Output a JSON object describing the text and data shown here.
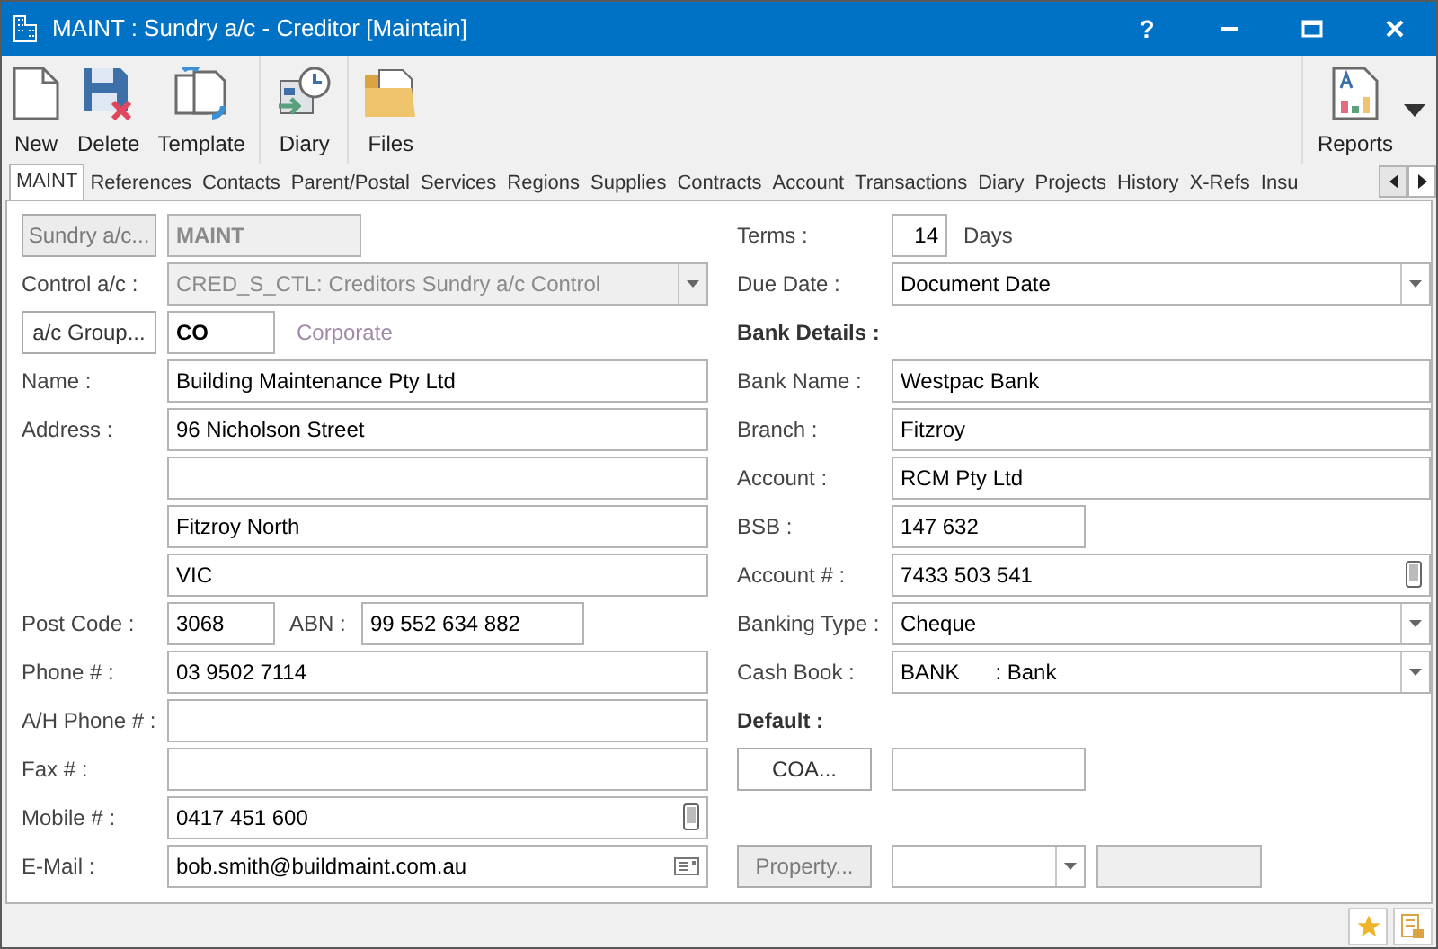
{
  "window": {
    "title": "MAINT : Sundry a/c - Creditor [Maintain]",
    "help": "?"
  },
  "toolbar": {
    "groups": [
      [
        {
          "label": "New"
        },
        {
          "label": "Delete"
        },
        {
          "label": "Template"
        }
      ],
      [
        {
          "label": "Diary"
        }
      ],
      [
        {
          "label": "Files"
        }
      ]
    ],
    "right": [
      {
        "label": "Reports"
      }
    ]
  },
  "tabs": [
    {
      "label": "MAINT",
      "selected": true
    },
    {
      "label": "References",
      "selected": false
    },
    {
      "label": "Contacts",
      "selected": false
    },
    {
      "label": "Parent/Postal",
      "selected": false
    },
    {
      "label": "Services",
      "selected": false
    },
    {
      "label": "Regions",
      "selected": false
    },
    {
      "label": "Supplies",
      "selected": false
    },
    {
      "label": "Contracts",
      "selected": false
    },
    {
      "label": "Account",
      "selected": false
    },
    {
      "label": "Transactions",
      "selected": false
    },
    {
      "label": "Diary",
      "selected": false
    },
    {
      "label": "Projects",
      "selected": false
    },
    {
      "label": "History",
      "selected": false
    },
    {
      "label": "X-Refs",
      "selected": false
    },
    {
      "label": "Insu",
      "selected": false
    }
  ],
  "left": [
    {
      "kind": "button-field",
      "button": "Sundry a/c...",
      "button_disabled": true,
      "value": "MAINT",
      "disabled": true
    },
    {
      "kind": "combo",
      "label": "Control a/c :",
      "value": "CRED_S_CTL: Creditors Sundry a/c Control",
      "disabled": true
    },
    {
      "kind": "group-field",
      "button": "a/c Group...",
      "button_disabled": false,
      "value": "CO",
      "disabled": false,
      "note": "Corporate"
    },
    {
      "kind": "field",
      "label": "Name :",
      "value": "Building Maintenance Pty Ltd"
    },
    {
      "kind": "field",
      "label": "Address :",
      "value": "96 Nicholson Street"
    },
    {
      "kind": "field"
    },
    {
      "kind": "field",
      "value": "Fitzroy North"
    },
    {
      "kind": "field",
      "value": "VIC"
    },
    {
      "kind": "pair",
      "label": "Post Code :",
      "value": "3068",
      "label2": "ABN :",
      "value2": "99 552 634 882"
    },
    {
      "kind": "field",
      "label": "Phone # :",
      "value": "03 9502 7114"
    },
    {
      "kind": "field",
      "label": "A/H Phone # :"
    },
    {
      "kind": "field",
      "label": "Fax # :"
    },
    {
      "kind": "mobile-field",
      "label": "Mobile # :",
      "value": "0417 451 600"
    },
    {
      "kind": "email-field",
      "label": "E-Mail :",
      "value": "bob.smith@buildmaint.com.au"
    }
  ],
  "right": [
    {
      "kind": "terms",
      "label": "Terms :",
      "value": "14",
      "unit": "Days"
    },
    {
      "kind": "combo",
      "label": "Due Date :",
      "value": "Document Date",
      "disabled": false
    },
    {
      "kind": "heading",
      "label": "Bank Details :"
    },
    {
      "kind": "field",
      "label": "Bank Name :",
      "value": "Westpac Bank"
    },
    {
      "kind": "field",
      "label": "Branch :",
      "value": "Fitzroy"
    },
    {
      "kind": "field",
      "label": "Account :",
      "value": "RCM Pty Ltd"
    },
    {
      "kind": "medium-field",
      "label": "BSB :",
      "value": "147 632"
    },
    {
      "kind": "mobile-field",
      "label": "Account # :",
      "value": "7433 503 541"
    },
    {
      "kind": "combo",
      "label": "Banking Type :",
      "value": "Cheque",
      "disabled": false
    },
    {
      "kind": "combo",
      "label": "Cash Book :",
      "value": "BANK      : Bank",
      "disabled": false
    },
    {
      "kind": "heading",
      "label": "Default :"
    },
    {
      "kind": "button-field",
      "button": "COA...",
      "button_disabled": false,
      "disabled": false
    },
    {
      "kind": "blank"
    },
    {
      "kind": "property",
      "button": "Property...",
      "button_disabled": true
    }
  ]
}
